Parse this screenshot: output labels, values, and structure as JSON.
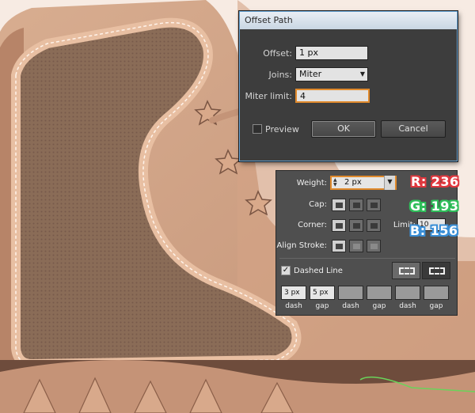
{
  "offset_dialog": {
    "title": "Offset Path",
    "offset_label": "Offset:",
    "offset_value": "1 px",
    "joins_label": "Joins:",
    "joins_value": "Miter",
    "miter_limit_label": "Miter limit:",
    "miter_limit_value": "4",
    "preview_label": "Preview",
    "preview_checked": false,
    "ok_label": "OK",
    "cancel_label": "Cancel"
  },
  "stroke_panel": {
    "weight_label": "Weight:",
    "weight_value": "2 px",
    "cap_label": "Cap:",
    "corner_label": "Corner:",
    "limit_label": "Limit:",
    "limit_value": "10",
    "align_stroke_label": "Align Stroke:",
    "dashed_line_label": "Dashed Line",
    "dashed_line_checked": true,
    "dashes": [
      {
        "value": "3 px",
        "label": "dash"
      },
      {
        "value": "5 px",
        "label": "gap"
      },
      {
        "value": "",
        "label": "dash"
      },
      {
        "value": "",
        "label": "gap"
      },
      {
        "value": "",
        "label": "dash"
      },
      {
        "value": "",
        "label": "gap"
      }
    ]
  },
  "color_readout": {
    "r": "R: 236",
    "g": "G: 193",
    "b": "B: 156",
    "r_color": "#e0383e",
    "g_color": "#2fbf5a",
    "b_color": "#3b8fd6"
  },
  "colors": {
    "fill_color": "#ecc19c",
    "dialog_bg": "#3d3d3d",
    "panel_bg": "#4f4f4f",
    "focus_accent": "#e08a2c"
  }
}
